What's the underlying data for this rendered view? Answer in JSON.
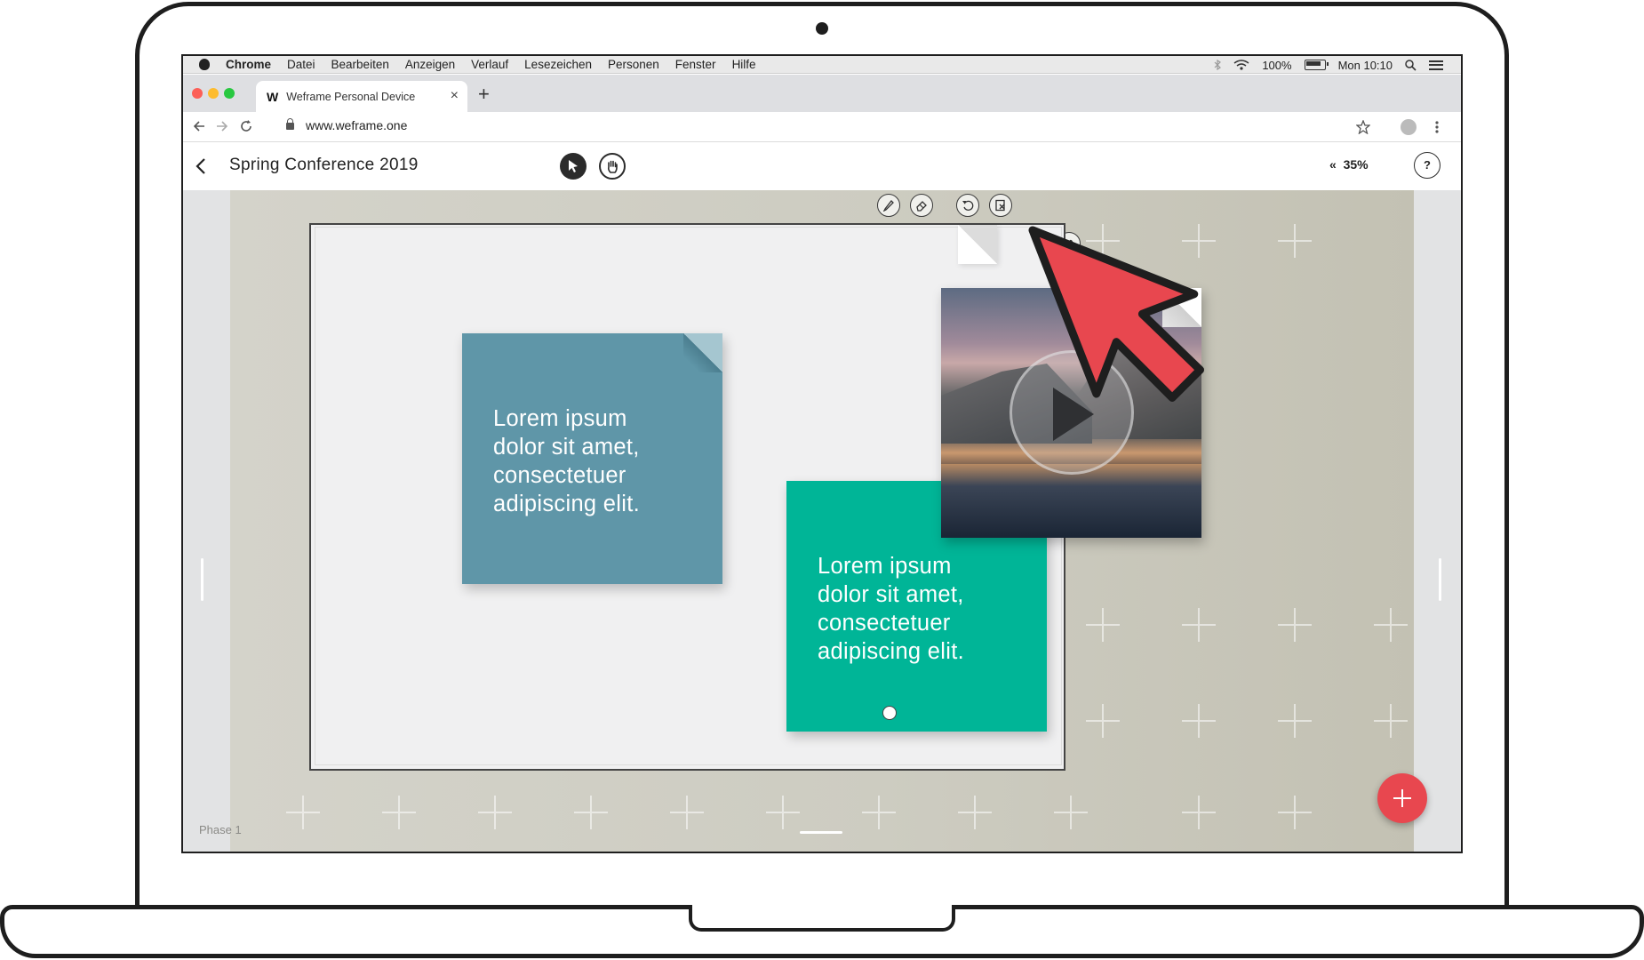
{
  "menubar": {
    "app": "Chrome",
    "items": [
      "Datei",
      "Bearbeiten",
      "Anzeigen",
      "Verlauf",
      "Lesezeichen",
      "Personen",
      "Fenster",
      "Hilfe"
    ],
    "battery": "100%",
    "clock": "Mon 10:10",
    "icons": [
      "apple-icon",
      "bluetooth-icon",
      "wifi-icon",
      "battery-icon",
      "search-icon",
      "menu-icon"
    ]
  },
  "browser": {
    "tab_logo": "W",
    "tab_title": "Weframe Personal Device",
    "tab_close": "×",
    "new_tab": "+",
    "url": "www.weframe.one"
  },
  "app": {
    "title": "Spring Conference 2019",
    "zoom_prefix": "«",
    "zoom": "35%",
    "help": "?",
    "phase": "Phase 1"
  },
  "notes": [
    {
      "text": "Lorem ipsum\ndolor sit amet,\nconsectetuer\nadipiscing elit.",
      "color": "#5f96a8"
    },
    {
      "text": "Lorem ipsum\ndolor sit amet,\nconsectetuer\nadipiscing elit.",
      "color": "#00b597"
    }
  ],
  "frame_tools": [
    "pencil-icon",
    "eraser-icon",
    "undo-icon",
    "delete-frame-icon"
  ],
  "side_tools": [
    "link-icon",
    "copy-icon",
    "settings-icon",
    "help-icon"
  ],
  "side_help": "?",
  "colors": {
    "accent": "#e8474f",
    "arrow": "#e8474f",
    "canvas": "#cdccc1"
  }
}
